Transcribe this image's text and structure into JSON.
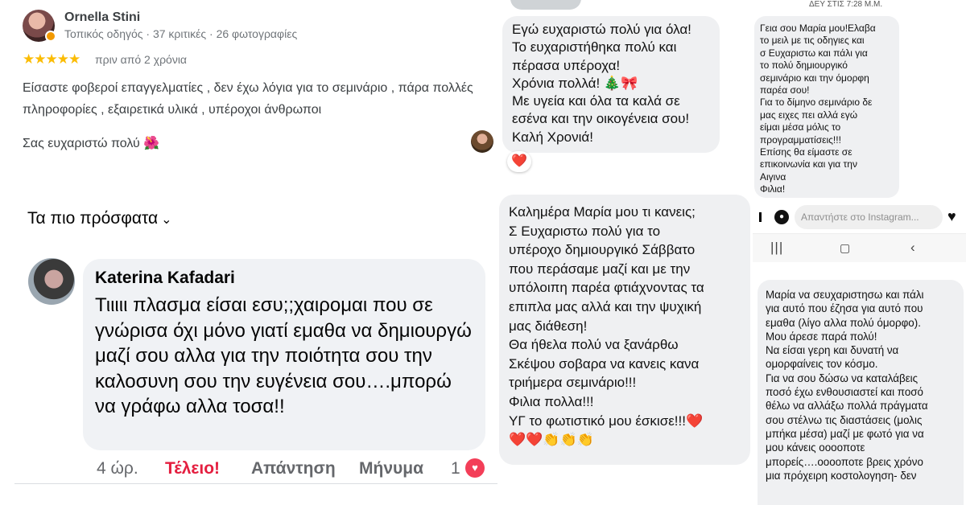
{
  "review": {
    "name": "Ornella Stini",
    "meta": "Τοπικός οδηγός · 37 κριτικές · 26 φωτογραφίες",
    "rating": 5,
    "stars": "★★★★★",
    "time": "πριν από 2 χρόνια",
    "body": "Είσαστε φοβεροί επαγγελματίες , δεν έχω λόγια για το σεμινάριο , πάρα πολλές πληροφορίες , εξαιρετικά υλικά , υπέροχοι άνθρωποι",
    "thanks": "Σας ευχαριστώ πολύ 🌺"
  },
  "facebook": {
    "sort_label": "Τα πιο πρόσφατα",
    "sort_chevron": "⌄",
    "comment": {
      "author": "Katerina Kafadari",
      "text": "Τιιιιι πλασμα είσαι εσυ;;χαιρομαι που σε γνώρισα όχι μόνο γιατί εμαθα να δημιουργώ μαζί σου αλλα για την ποιότητα σου την καλοσυνη σου την ευγένεια σου….μπορώ να γράφω αλλα τοσα!!",
      "time": "4 ώρ.",
      "reaction_label": "Τέλειο!",
      "reply_label": "Απάντηση",
      "message_label": "Μήνυμα",
      "reaction_count": "1",
      "reaction_icon": "heart-icon"
    }
  },
  "chat": {
    "messages": [
      {
        "lines": [
          "Εγώ ευχαριστώ πολύ για όλα!",
          "Το ευχαριστήθηκα πολύ και",
          "πέρασα υπέροχα!",
          "Χρόνια πολλά! 🎄🎀",
          "Με υγεία και όλα τα καλά σε",
          "εσένα και την οικογένεια σου!",
          "Καλή Χρονιά!"
        ],
        "reaction": "❤️"
      },
      {
        "lines": [
          "Καλημέρα Μαρία μου τι κανεις;",
          "Σ Ευχαριστω πολύ για το",
          "υπέροχο δημιουργικό Σάββατο",
          "που περάσαμε μαζί και με την",
          "υπόλοιπη παρέα φτιάχνοντας τα",
          "επιπλα μας αλλά και την ψυχική",
          "μας διάθεση!",
          "Θα ήθελα πολύ να ξανάρθω",
          "Σκέψου σοβαρα να κανεις κανα",
          "τριήμερα σεμινάριο!!!",
          "Φιλια πολλα!!!",
          "ΥΓ το φωτιστικό μου έσκισε!!!❤️",
          "❤️❤️👏👏👏"
        ]
      }
    ]
  },
  "instagram": {
    "timestamp": "ΔΕΥ ΣΤΙΣ 7:28 Μ.Μ.",
    "lines": [
      "Γεια σου Μαρία μου!Ελαβα",
      "το μειλ με τις οδηγιες και",
      "σ Ευχαριστω και πάλι για",
      "το πολύ δημιουργικό",
      "σεμινάριο  και την όμορφη",
      "παρέα σου!",
      "Για το δίμηνο σεμινάριο δε",
      "μας ειχες πει αλλά εγώ",
      "είμαι μέσα μόλις το",
      "προγραμματίσεις!!!",
      "Επίσης θα είμαστε σε",
      "επικοινωνία και για την",
      "Αιγινα",
      "Φιλια!"
    ],
    "reply_placeholder": "Απαντήστε στο Instagram...",
    "nav": {
      "recent": "|||",
      "home": "▢",
      "back": "‹"
    }
  },
  "note": {
    "lines": [
      "Μαρία να σευχαριστησω και πάλι",
      "για αυτό που έζησα για αυτό που",
      "εμαθα (λίγο αλλα πολύ όμορφο).",
      "Μου άρεσε παρά πολύ!",
      "Να είσαι γερη και δυνατή να",
      "ομορφαίνεις τον κόσμο.",
      "Για να σου δώσω να καταλάβεις",
      "ποσό έχω ενθουσιαστεί και ποσό",
      "θέλω να αλλάξω πολλά πράγματα",
      "σου στέλνω τις διαστάσεις (μολις",
      "μπήκα μέσα) μαζί με φωτό για να",
      "μου κάνεις οοοοποτε",
      "μπορείς….οοοοποτε βρεις χρόνο",
      "μια πρόχειρη κοστολογηση- δεν"
    ]
  }
}
